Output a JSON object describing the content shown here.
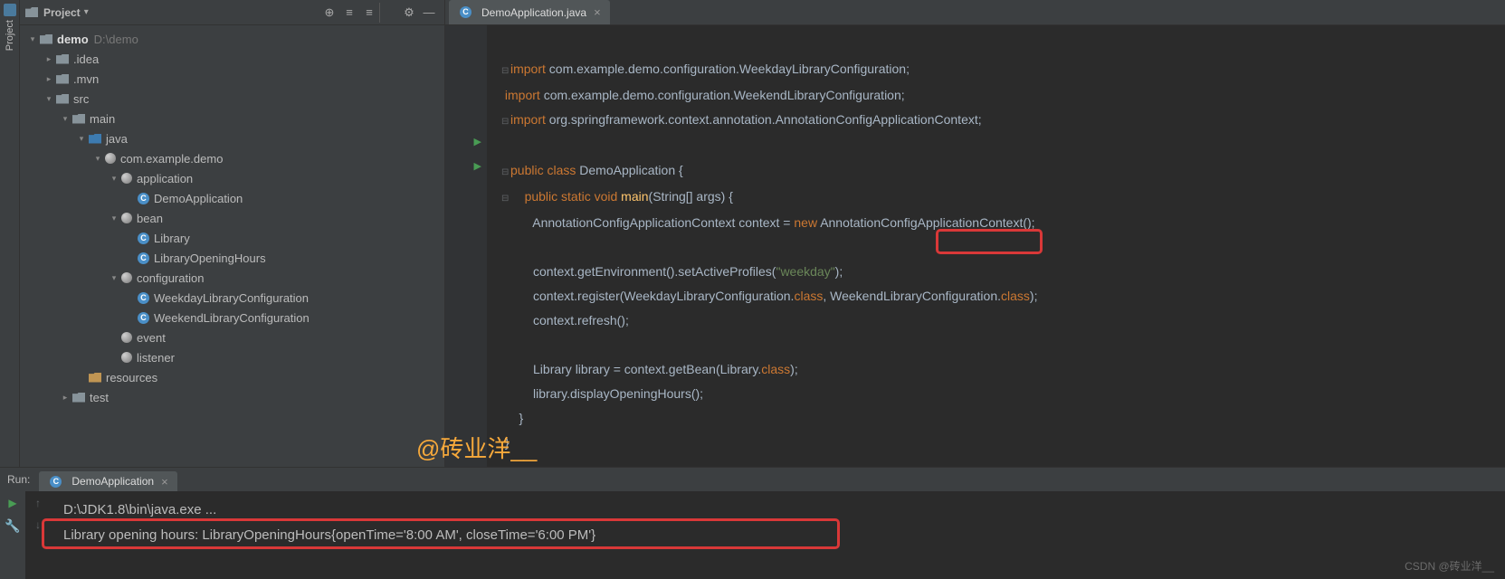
{
  "sidebarTab": "Project",
  "panel": {
    "title": "Project"
  },
  "toolbarIcons": {
    "target": "⊕",
    "collapse": "≡",
    "expand": "≡",
    "settings": "⚙",
    "hide": "—"
  },
  "tree": {
    "root": {
      "name": "demo",
      "path": "D:\\demo"
    },
    "idea": ".idea",
    "mvn": ".mvn",
    "src": "src",
    "main": "main",
    "java": "java",
    "pkg": "com.example.demo",
    "application": "application",
    "demoApp": "DemoApplication",
    "bean": "bean",
    "library": "Library",
    "hours": "LibraryOpeningHours",
    "configuration": "configuration",
    "wkday": "WeekdayLibraryConfiguration",
    "wkend": "WeekendLibraryConfiguration",
    "event": "event",
    "listener": "listener",
    "resources": "resources",
    "test": "test"
  },
  "editorTab": {
    "name": "DemoApplication.java"
  },
  "code": {
    "l1a": "import ",
    "l1b": "com.example.demo.configuration.WeekdayLibraryConfiguration",
    "l1c": ";",
    "l2a": "import ",
    "l2b": "com.example.demo.configuration.WeekendLibraryConfiguration",
    "l2c": ";",
    "l3a": "import ",
    "l3b": "org.springframework.context.annotation.AnnotationConfigApplicationContext",
    "l3c": ";",
    "l5a": "public class ",
    "l5b": "DemoApplication {",
    "l6a": "public static void ",
    "l6b": "main",
    "l6c": "(String[] args) {",
    "l7a": "AnnotationConfigApplicationContext context = ",
    "l7b": "new ",
    "l7c": "AnnotationConfigApplicationContext();",
    "l9a": "context.getEnvironment().setActiveProfiles(",
    "l9b": "\"weekday\"",
    "l9c": ");",
    "l10a": "context.register(WeekdayLibraryConfiguration.",
    "l10b": "class",
    "l10c": ", WeekendLibraryConfiguration.",
    "l10d": "class",
    "l10e": ");",
    "l11": "context.refresh();",
    "l13a": "Library library = context.getBean(Library.",
    "l13b": "class",
    "l13c": ");",
    "l14": "library.displayOpeningHours();",
    "l15": "}",
    "l16": "}"
  },
  "run": {
    "title": "Run:",
    "tab": "DemoApplication",
    "line1": "D:\\JDK1.8\\bin\\java.exe ...",
    "line2": "Library opening hours: LibraryOpeningHours{openTime='8:00 AM', closeTime='6:00 PM'}"
  },
  "watermark": "@砖业洋__",
  "csdn": "CSDN @砖业洋__"
}
